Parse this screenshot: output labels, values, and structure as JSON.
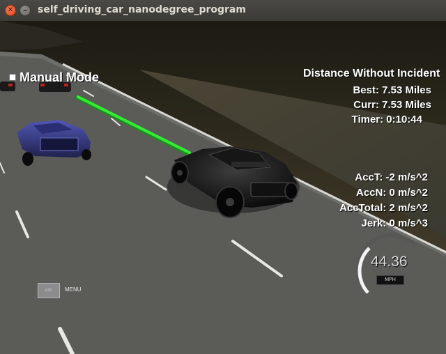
{
  "window": {
    "title": "self_driving_car_nanodegree_program"
  },
  "hud": {
    "mode_label": "Manual Mode",
    "distance_title": "Distance Without Incident",
    "best": "Best: 7.53 Miles",
    "curr": "Curr: 7.53 Miles",
    "timer": "Timer: 0:10:44",
    "acct": "AccT: -2 m/s^2",
    "accn": "AccN: 0 m/s^2",
    "acctotal": "AccTotal: 2 m/s^2",
    "jerk": "Jerk: 0 m/s^3",
    "speed": "44.36",
    "speed_unit": "MPH",
    "esc_label": "ESC",
    "menu_label": "MENU"
  },
  "colors": {
    "planned_path": "#2bdc2b",
    "road": "#5a5a58",
    "ground_top": "#4a4430"
  }
}
